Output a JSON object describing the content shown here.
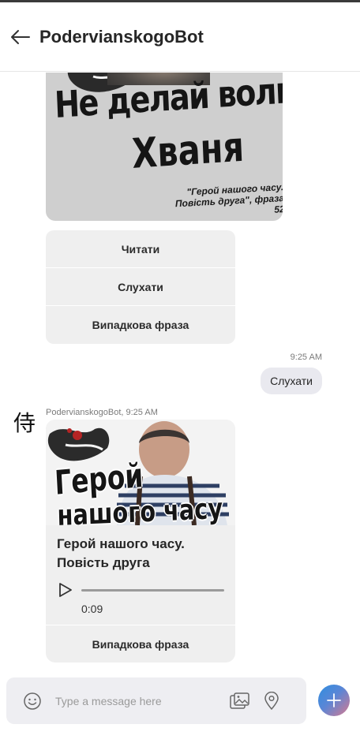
{
  "header": {
    "title": "PodervianskogoBot",
    "back_icon": "arrow-left-icon"
  },
  "top_image": {
    "line1": "Не делай волни,",
    "line2": "Хваня",
    "caption_line1": "\"Герой нашого часу.",
    "caption_line2": "Повість друга\", фраза 52"
  },
  "keyboard1": {
    "buttons": [
      "Читати",
      "Слухати",
      "Випадкова фраза"
    ]
  },
  "outgoing": {
    "time": "9:25 AM",
    "text": "Слухати"
  },
  "bot_message": {
    "avatar_glyph": "侍",
    "sender": "PodervianskogoBot, 9:25 AM",
    "image_line1": "Герой",
    "image_line2": "нашого часу",
    "title": "Герой нашого часу. Повість друга",
    "audio_time": "0:09",
    "audio_progress": 0.0,
    "button": "Випадкова фраза"
  },
  "composer": {
    "placeholder": "Type a message here",
    "icons": [
      "emoji-icon",
      "image-icon",
      "location-icon",
      "plus-icon"
    ]
  },
  "colors": {
    "send_gradient_start": "#2f8fe0",
    "send_gradient_end": "#d7798f",
    "bubble": "#efefef"
  }
}
